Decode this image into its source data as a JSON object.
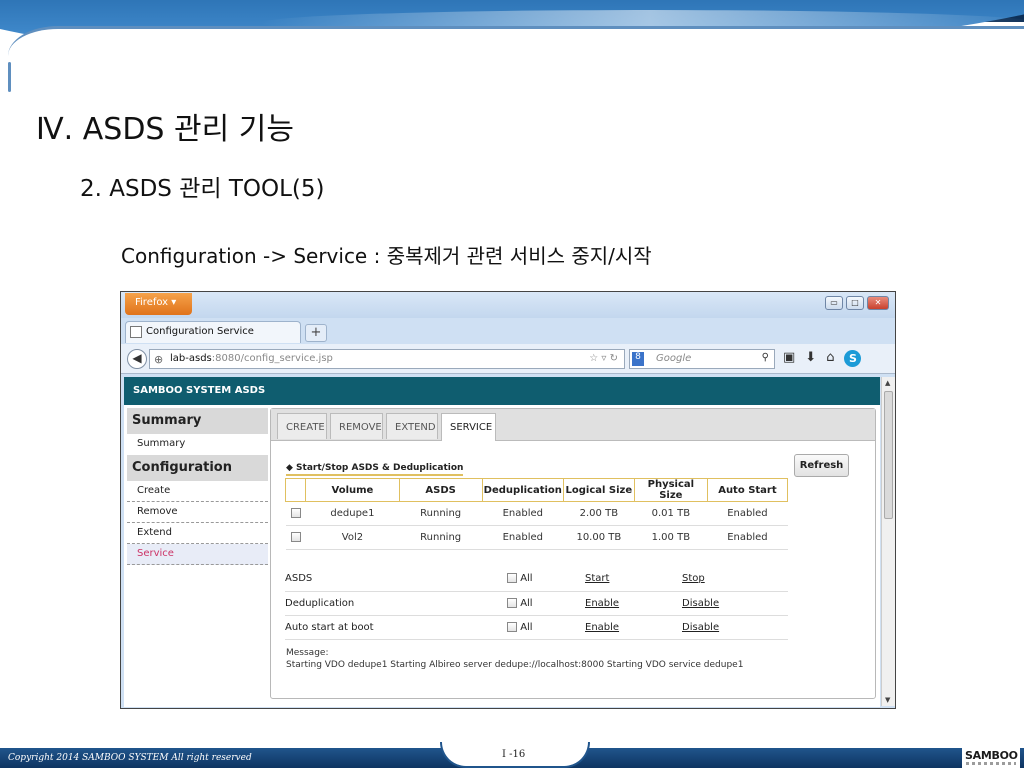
{
  "slide": {
    "title": "Ⅳ. ASDS 관리 기능",
    "subtitle": "2. ASDS 관리 TOOL(5)",
    "description": "Configuration -> Service : 중복제거 관련 서비스 중지/시작",
    "copyright": "Copyright 2014 SAMBOO SYSTEM All right reserved",
    "page_number": "I -16",
    "logo_text": "SAMBOO"
  },
  "browser": {
    "firefox_label": "Firefox ▾",
    "tab_title": "Configuration Service",
    "new_tab_symbol": "+",
    "url_host": "lab-asds",
    "url_path": ":8080/config_service.jsp",
    "search_placeholder": "Google",
    "window_buttons": [
      "▭",
      "□",
      "✕"
    ]
  },
  "app": {
    "header": "SAMBOO SYSTEM ASDS",
    "sidebar": {
      "sections": [
        {
          "title": "Summary",
          "items": [
            "Summary"
          ]
        },
        {
          "title": "Configuration",
          "items": [
            "Create",
            "Remove",
            "Extend",
            "Service"
          ]
        }
      ]
    },
    "tabs": [
      "CREATE",
      "REMOVE",
      "EXTEND",
      "SERVICE"
    ],
    "active_tab": "SERVICE",
    "section_title": "◆ Start/Stop ASDS & Deduplication",
    "refresh_label": "Refresh",
    "volume_table": {
      "columns": [
        "Volume",
        "ASDS",
        "Deduplication",
        "Logical Size",
        "Physical Size",
        "Auto Start"
      ],
      "rows": [
        {
          "volume": "dedupe1",
          "asds": "Running",
          "dedup": "Enabled",
          "logical": "2.00 TB",
          "physical": "0.01 TB",
          "auto": "Enabled"
        },
        {
          "volume": "Vol2",
          "asds": "Running",
          "dedup": "Enabled",
          "logical": "10.00 TB",
          "physical": "1.00 TB",
          "auto": "Enabled"
        }
      ]
    },
    "controls": [
      {
        "label": "ASDS",
        "all": "All",
        "action1": "Start",
        "action2": "Stop"
      },
      {
        "label": "Deduplication",
        "all": "All",
        "action1": "Enable",
        "action2": "Disable"
      },
      {
        "label": "Auto start at boot",
        "all": "All",
        "action1": "Enable",
        "action2": "Disable"
      }
    ],
    "message_label": "Message:",
    "message_text": "Starting VDO dedupe1 Starting Albireo server dedupe://localhost:8000 Starting VDO service dedupe1"
  }
}
